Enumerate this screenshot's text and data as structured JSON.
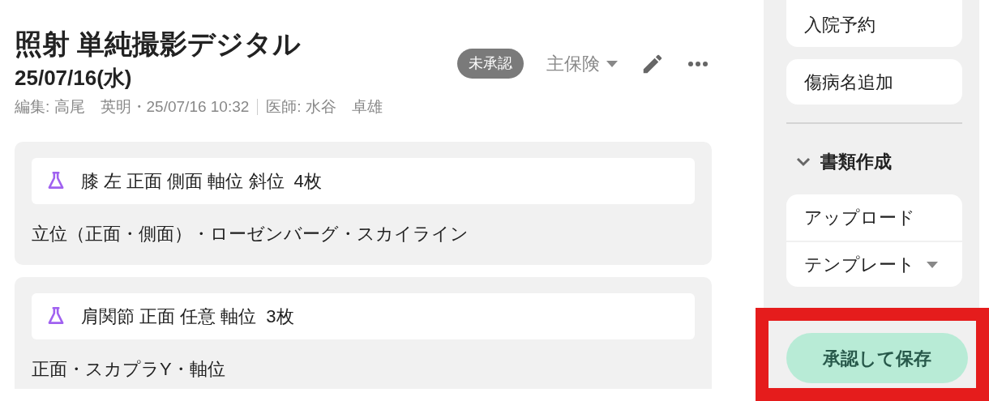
{
  "header": {
    "title": "照射 単純撮影デジタル",
    "date": "25/07/16(水)",
    "editor": "編集: 高尾　英明・25/07/16 10:32",
    "doctor": "医師: 水谷　卓雄",
    "status": "未承認",
    "insurance": "主保険"
  },
  "orders": [
    {
      "name": "膝 左 正面 側面 軸位 斜位",
      "count": "4枚",
      "description": "立位（正面・側面）・ローゼンバーグ・スカイライン"
    },
    {
      "name": "肩関節 正面 任意 軸位",
      "count": "3枚",
      "description": "正面・スカプラY・軸位"
    }
  ],
  "sidebar": {
    "actions": [
      "入院予約",
      "傷病名追加"
    ],
    "section": {
      "title": "書類作成",
      "expanded": true,
      "items": [
        {
          "label": "アップロード",
          "kind": "plain"
        },
        {
          "label": "テンプレート",
          "kind": "dropdown"
        }
      ]
    },
    "save_button": "承認して保存"
  }
}
